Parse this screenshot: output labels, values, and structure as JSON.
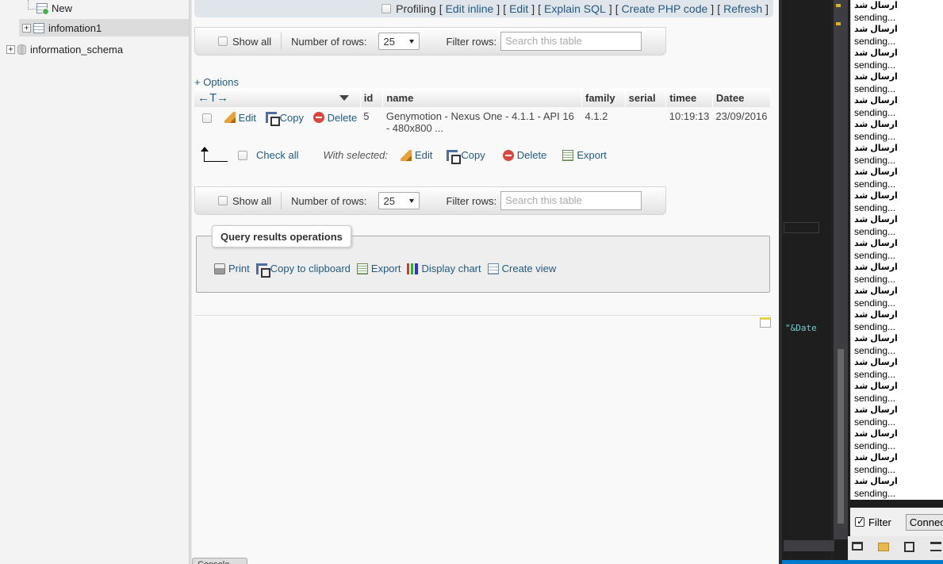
{
  "nav": {
    "new_label": "New",
    "table_label": "infomation1",
    "schema_label": "information_schema",
    "expand_symbol": "+"
  },
  "top_toolbar": {
    "profiling": "Profiling",
    "brackets": [
      "[",
      "]"
    ],
    "links": [
      "Edit inline",
      "Edit",
      "Explain SQL",
      "Create PHP code",
      "Refresh"
    ]
  },
  "nav_bar": {
    "show_all": "Show all",
    "rows_label": "Number of rows:",
    "rows_value": "25",
    "filter_label": "Filter rows:",
    "filter_placeholder": "Search this table"
  },
  "options_link": "+ Options",
  "table": {
    "sort_arrows": "←T→",
    "columns": [
      "id",
      "name",
      "family",
      "serial",
      "timee",
      "Datee"
    ],
    "row": {
      "edit": "Edit",
      "copy": "Copy",
      "delete": "Delete",
      "id": "5",
      "name": "Genymotion - Nexus One - 4.1.1 - API 16 - 480x800 ...",
      "family": "4.1.2",
      "serial": "",
      "timee": "10:19:13",
      "datee": "23/09/2016"
    }
  },
  "bulk": {
    "check_all": "Check all",
    "with_selected": "With selected:",
    "edit": "Edit",
    "copy": "Copy",
    "delete": "Delete",
    "export": "Export"
  },
  "query_ops": {
    "title": "Query results operations",
    "print": "Print",
    "copy_clipboard": "Copy to clipboard",
    "export": "Export",
    "display_chart": "Display chart",
    "create_view": "Create view"
  },
  "console_tab": "Console",
  "editor": {
    "code_fragment": "\"&Date",
    "output_lines": [
      "ارسال شد",
      "sending...",
      "ارسال شد",
      "sending...",
      "ارسال شد",
      "sending...",
      "ارسال شد",
      "sending...",
      "ارسال شد",
      "sending...",
      "ارسال شد",
      "sending...",
      "ارسال شد",
      "sending...",
      "ارسال شد",
      "sending...",
      "ارسال شد",
      "sending...",
      "ارسال شد",
      "sending...",
      "ارسال شد",
      "sending...",
      "ارسال شد",
      "sending...",
      "ارسال شد",
      "sending...",
      "ارسال شد",
      "sending...",
      "ارسال شد",
      "sending...",
      "ارسال شد",
      "sending...",
      "ارسال شد",
      "sending...",
      "ارسال شد",
      "sending...",
      "ارسال شد",
      "sending...",
      "ارسال شد",
      "sending...",
      "ارسال شد",
      "sending..."
    ],
    "filter_label": "Filter",
    "connect_label": "Connect"
  }
}
